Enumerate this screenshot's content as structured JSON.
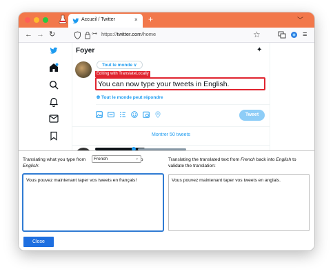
{
  "browser": {
    "tab_title": "Accueil / Twitter",
    "tab_close": "×",
    "new_tab": "+",
    "tabs_menu_icon": "chevron-down-icon",
    "url_prefix": "https://",
    "url_host": "twitter.com",
    "url_path": "/home",
    "bookmark_icon": "☆",
    "back_icon": "←",
    "forward_icon": "→",
    "reload_icon": "↻",
    "menu_icon": "≡",
    "accent_color": "#f2784b"
  },
  "twitter": {
    "page_title": "Foyer",
    "audience_label": "Tout le monde ∨",
    "translate_badge": "Editing with TranslateLocally",
    "tweet_text": "You can now type your tweets in English.",
    "reply_setting": "Tout le monde peut répondre",
    "tweet_button": "Tweet",
    "show_more": "Montrer 50 tweets",
    "brand_color": "#1d9bf0",
    "sidebar_icons": [
      "twitter-logo-icon",
      "home-icon",
      "search-icon",
      "notifications-icon",
      "messages-icon",
      "bookmark-icon"
    ],
    "toolbar_icons": [
      "image-icon",
      "gif-icon",
      "poll-icon",
      "emoji-icon",
      "schedule-icon",
      "location-icon"
    ]
  },
  "translator": {
    "source_label_pre": "Translating what you type from",
    "source_label_post": "to",
    "target_language": "English",
    "target_suffix": ":",
    "source_language": "French",
    "back_label_pre": "Translating the translated text from",
    "back_label_lang1": "French",
    "back_label_mid": "back into",
    "back_label_lang2": "English",
    "back_label_post": "to validate the translation:",
    "source_text": "Vous pouvez maintenant taper vos tweets en français!",
    "back_text": "Vous pouvez maintenant taper vos tweets en anglais.",
    "close_button": "Close",
    "highlight_color": "#e0242f"
  }
}
